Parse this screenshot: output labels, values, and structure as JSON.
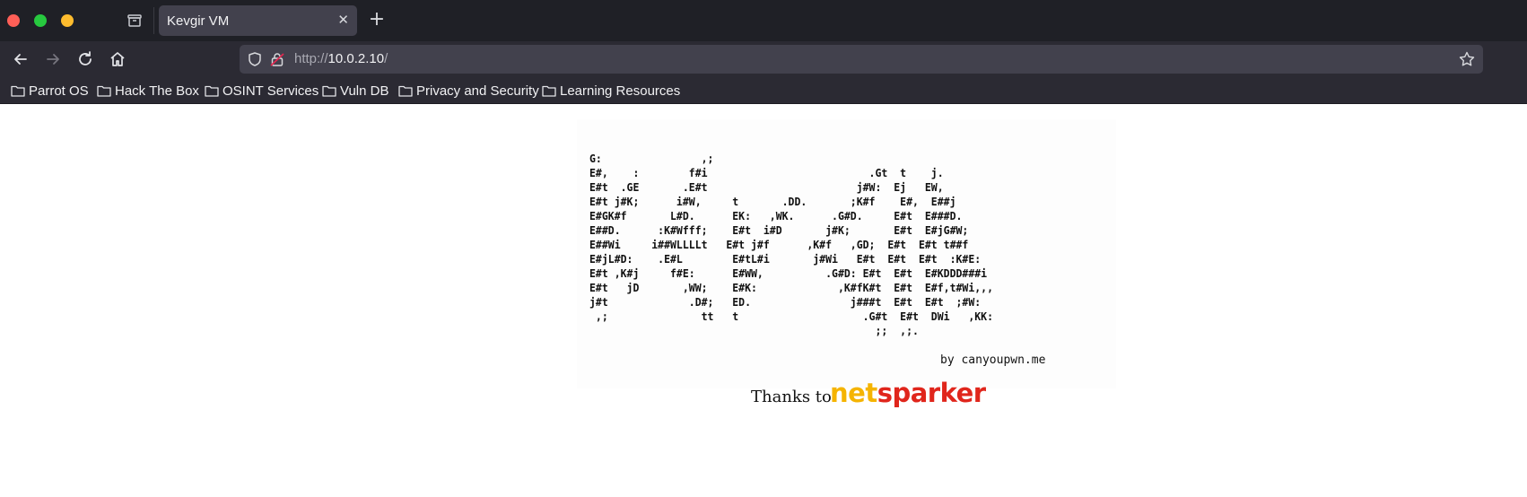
{
  "browser": {
    "tab_title": "Kevgir VM",
    "url_scheme": "http://",
    "url_host": "10.0.2.10",
    "url_path": "/"
  },
  "bookmarks": [
    {
      "label": "Parrot OS",
      "icon": "folder-icon"
    },
    {
      "label": "Hack The Box",
      "icon": "folder-icon"
    },
    {
      "label": "OSINT Services",
      "icon": "folder-icon"
    },
    {
      "label": "Vuln DB",
      "icon": "folder-icon"
    },
    {
      "label": "Privacy and Security",
      "icon": "folder-icon"
    },
    {
      "label": "Learning Resources",
      "icon": "folder-icon"
    }
  ],
  "page": {
    "ascii_art": "G:                ,;\nE#,    :        f#i                          .Gt  t    j.\nE#t  .GE       .E#t                        j#W:  Ej   EW,\nE#t j#K;      i#W,     t       .DD.       ;K#f    E#,  E##j\nE#GK#f       L#D.      EK:   ,WK.      .G#D.     E#t  E###D.\nE##D.      :K#Wfff;    E#t  i#D       j#K;       E#t  E#jG#W;\nE##Wi     i##WLLLLt   E#t j#f      ,K#f   ,GD;  E#t  E#t t##f\nE#jL#D:    .E#L        E#tL#i       j#Wi   E#t  E#t  E#t  :K#E:\nE#t ,K#j     f#E:      E#WW,          .G#D: E#t  E#t  E#KDDD###i\nE#t   jD       ,WW;    E#K:             ,K#fK#t  E#t  E#f,t#Wi,,,\nj#t             .D#;   ED.                j###t  E#t  E#t  ;#W:\n ,;               tt   t                    .G#t  E#t  DWi   ,KK:\n                                              ;;  ,;.",
    "byline": "by canyoupwn.me",
    "thanks_text": "Thanks to",
    "logo_part1": "net",
    "logo_part2": "sparker",
    "logo_colors": {
      "net": "#f5b400",
      "sparker": "#e0261c"
    }
  }
}
